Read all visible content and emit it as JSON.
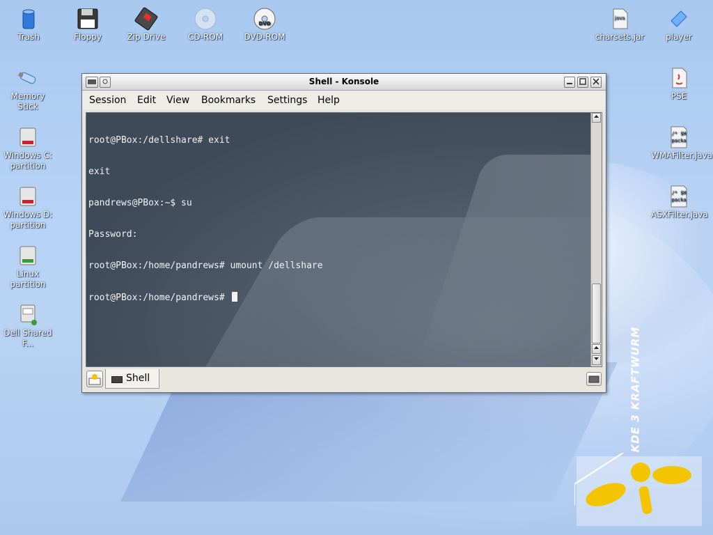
{
  "desktop": {
    "icons_left_top": [
      {
        "label": "Trash",
        "icon": "trash-icon"
      },
      {
        "label": "Floppy",
        "icon": "floppy-icon"
      },
      {
        "label": "Zip Drive",
        "icon": "zip-drive-icon"
      },
      {
        "label": "CD-ROM",
        "icon": "cdrom-icon"
      },
      {
        "label": "DVD-ROM",
        "icon": "dvdrom-icon"
      }
    ],
    "icons_left_column": [
      {
        "label": "Memory Stick",
        "icon": "usb-stick-icon"
      },
      {
        "label": "Windows C: partition",
        "icon": "hard-drive-icon"
      },
      {
        "label": "Windows D: partition",
        "icon": "hard-drive-icon"
      },
      {
        "label": "Linux partition",
        "icon": "hard-drive-icon"
      },
      {
        "label": "Dell Shared F...",
        "icon": "network-drive-icon"
      }
    ],
    "icons_right": [
      {
        "label": "charsets.jar",
        "icon": "jar-file-icon"
      },
      {
        "label": "player",
        "icon": "player-icon"
      },
      {
        "label": "PSE",
        "icon": "java-icon"
      },
      {
        "label": "WMAFilter.java",
        "icon": "java-source-icon"
      },
      {
        "label": "ASXFilter.java",
        "icon": "java-source-icon"
      }
    ],
    "wallpaper_brand": "KDE 3 KRAFTWURM"
  },
  "window": {
    "title": "Shell - Konsole",
    "menu": [
      "Session",
      "Edit",
      "View",
      "Bookmarks",
      "Settings",
      "Help"
    ],
    "terminal_lines": [
      "root@PBox:/dellshare# exit",
      "exit",
      "pandrews@PBox:~$ su",
      "Password:",
      "root@PBox:/home/pandrews# umount /dellshare",
      "root@PBox:/home/pandrews# "
    ],
    "tab_label": "Shell"
  },
  "colors": {
    "terminal_bg": "#46515f",
    "terminal_fg": "#f2f2f2",
    "desktop_bg": "#b5d2f5"
  }
}
